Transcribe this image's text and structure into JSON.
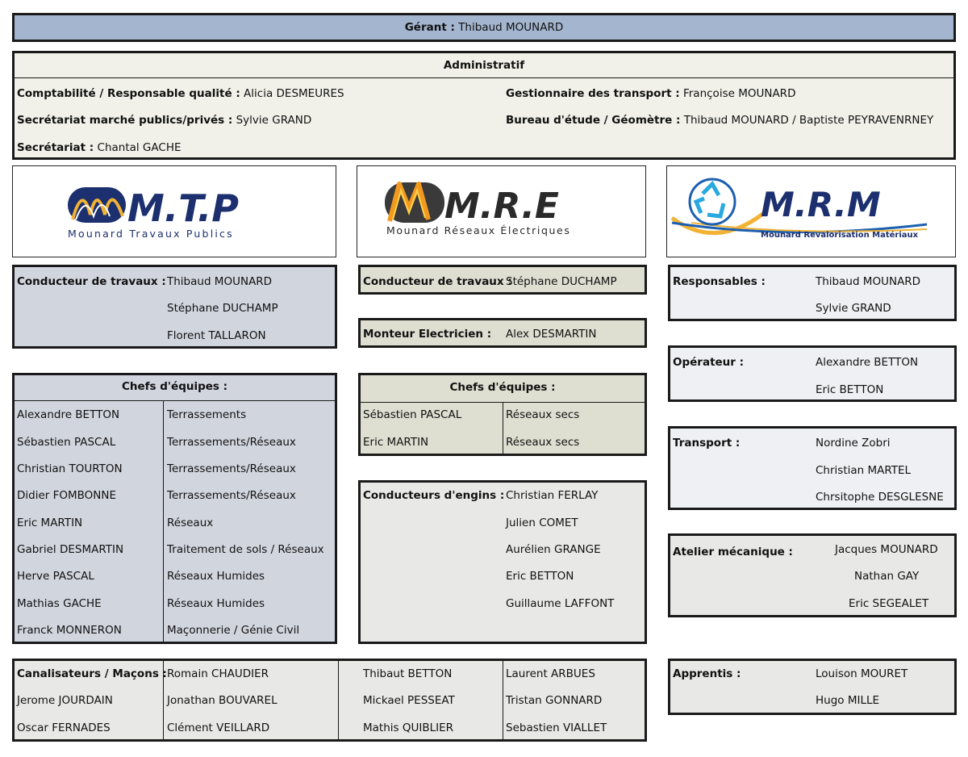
{
  "gerant": {
    "label": "Gérant :",
    "name": "Thibaud MOUNARD"
  },
  "admin": {
    "title": "Administratif",
    "rows": [
      {
        "label": "Comptabilité / Responsable qualité :",
        "value": "Alicia DESMEURES"
      },
      {
        "label": "Gestionnaire des transport :",
        "value": "Françoise MOUNARD"
      },
      {
        "label": "Secrétariat marché publics/privés :",
        "value": "Sylvie GRAND"
      },
      {
        "label": "Bureau d'étude / Géomètre :",
        "value": "Thibaud MOUNARD / Baptiste PEYRAVENRNEY"
      },
      {
        "label": "Secrétariat :",
        "value": "Chantal GACHE"
      }
    ]
  },
  "logos": {
    "mtp": {
      "name": "M.T.P",
      "sub": "Mounard Travaux Publics"
    },
    "mre": {
      "name": "M.R.E",
      "sub": "Mounard Réseaux Électriques"
    },
    "mrm": {
      "name": "M.R.M",
      "sub": "Mounard Revalorisation Matériaux"
    }
  },
  "mtp": {
    "conducteurs": {
      "label": "Conducteur de travaux :",
      "names": [
        "Thibaud MOUNARD",
        "Stéphane DUCHAMP",
        "Florent TALLARON"
      ]
    },
    "chefs": {
      "title": "Chefs d'équipes :",
      "rows": [
        {
          "name": "Alexandre BETTON",
          "role": "Terrassements"
        },
        {
          "name": "Sébastien PASCAL",
          "role": "Terrassements/Réseaux"
        },
        {
          "name": "Christian TOURTON",
          "role": "Terrassements/Réseaux"
        },
        {
          "name": "Didier FOMBONNE",
          "role": "Terrassements/Réseaux"
        },
        {
          "name": "Eric MARTIN",
          "role": "Réseaux"
        },
        {
          "name": "Gabriel DESMARTIN",
          "role": "Traitement de sols / Réseaux"
        },
        {
          "name": "Herve PASCAL",
          "role": "Réseaux Humides"
        },
        {
          "name": "Mathias GACHE",
          "role": "Réseaux Humides"
        },
        {
          "name": "Franck MONNERON",
          "role": "Maçonnerie / Génie Civil"
        }
      ]
    }
  },
  "mre": {
    "conducteur": {
      "label": "Conducteur de travaux :",
      "name": "Stéphane DUCHAMP"
    },
    "monteur": {
      "label": "Monteur Electricien :",
      "name": "Alex DESMARTIN"
    },
    "chefs": {
      "title": "Chefs d'équipes :",
      "rows": [
        {
          "name": "Sébastien PASCAL",
          "role": "Réseaux secs"
        },
        {
          "name": "Eric MARTIN",
          "role": "Réseaux secs"
        }
      ]
    },
    "engins": {
      "label": "Conducteurs  d'engins :",
      "names": [
        "Christian FERLAY",
        "Julien  COMET",
        "Aurélien GRANGE",
        "Eric BETTON",
        "Guillaume LAFFONT"
      ]
    }
  },
  "canalisateurs": {
    "label": "Canalisateurs / Maçons :",
    "col1": [
      "Jerome JOURDAIN",
      "Oscar FERNADES"
    ],
    "col2": [
      "Romain CHAUDIER",
      "Jonathan BOUVAREL",
      "Clément VEILLARD"
    ],
    "col3": [
      "Thibaut BETTON",
      "Mickael PESSEAT",
      "Mathis QUIBLIER"
    ],
    "col4": [
      "Laurent ARBUES",
      "Tristan GONNARD",
      "Sebastien VIALLET"
    ]
  },
  "mrm": {
    "responsables": {
      "label": "Responsables :",
      "names": [
        "Thibaud MOUNARD",
        "Sylvie GRAND"
      ]
    },
    "operateur": {
      "label": "Opérateur :",
      "names": [
        "Alexandre BETTON",
        "Eric BETTON"
      ]
    },
    "transport": {
      "label": "Transport :",
      "names": [
        "Nordine Zobri",
        "Christian MARTEL",
        "Chrsitophe DESGLESNE"
      ]
    },
    "atelier": {
      "label": "Atelier mécanique :",
      "names": [
        "Jacques MOUNARD",
        "Nathan GAY",
        "Eric SEGEALET"
      ]
    },
    "apprentis": {
      "label": "Apprentis :",
      "names": [
        "Louison MOURET",
        "Hugo MILLE"
      ]
    }
  },
  "colors": {
    "gerant_bg": "#a3b5cf",
    "admin_bg": "#f1f1ea",
    "mtp_bg": "#d1d5de",
    "mre_bg": "#dedfd1",
    "grey_bg": "#e8e8e6",
    "mrm_bg": "#eef0f3",
    "logo_blue": "#1c2f6e",
    "logo_gold": "#f2b233"
  }
}
